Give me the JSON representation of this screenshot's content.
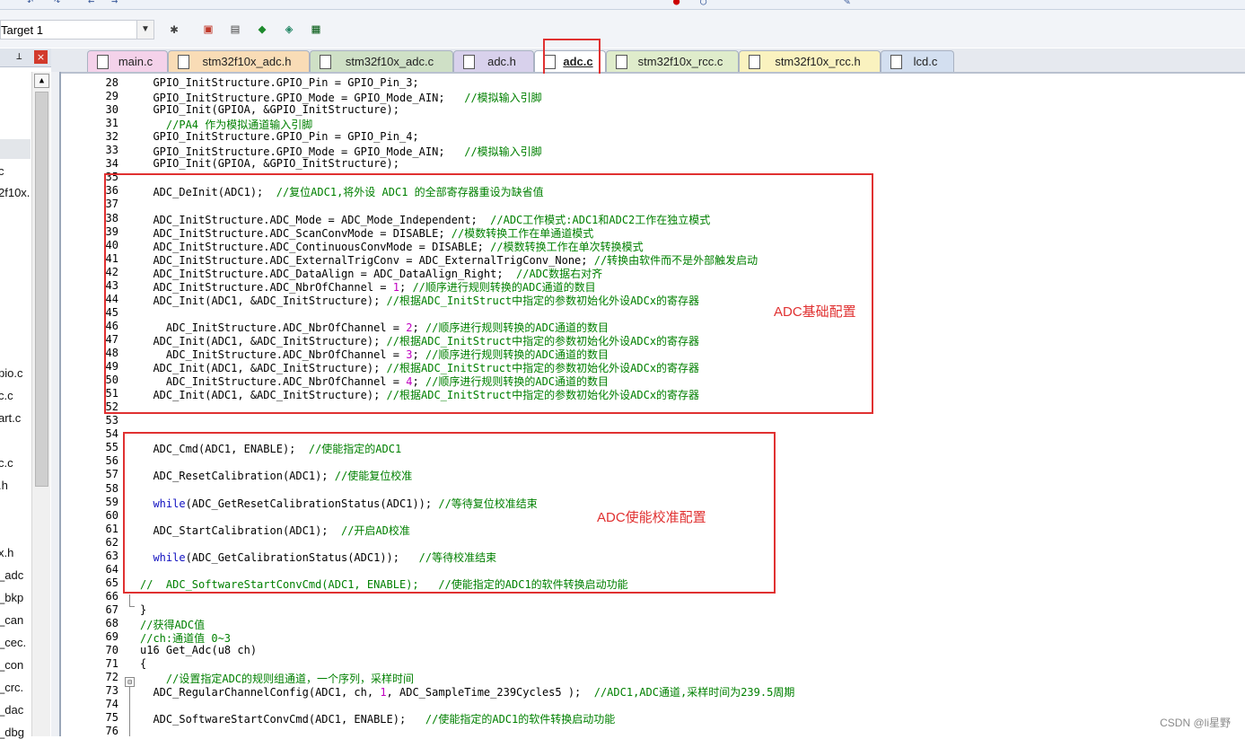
{
  "toolbar": {
    "target_label": "Target 1"
  },
  "tabs": [
    {
      "label": "main.c"
    },
    {
      "label": "stm32f10x_adc.h"
    },
    {
      "label": "stm32f10x_adc.c"
    },
    {
      "label": "adc.h"
    },
    {
      "label": "adc.c"
    },
    {
      "label": "stm32f10x_rcc.c"
    },
    {
      "label": "stm32f10x_rcc.h"
    },
    {
      "label": "lcd.c"
    }
  ],
  "project_pane": {
    "items": [
      "c",
      "2f10x.",
      "pio.c",
      "c.c",
      "art.c",
      "c.c",
      ".h",
      "x.h",
      "_adc",
      "_bkp",
      "_can",
      "_cec.",
      "_con",
      "_crc.",
      "_dac",
      "_dbg"
    ]
  },
  "editor": {
    "lines": [
      {
        "n": "28",
        "t": "  GPIO_InitStructure.GPIO_Pin = GPIO_Pin_3;"
      },
      {
        "n": "29",
        "t": "  GPIO_InitStructure.GPIO_Mode = GPIO_Mode_AIN;   //模拟输入引脚"
      },
      {
        "n": "30",
        "t": "  GPIO_Init(GPIOA, &GPIO_InitStructure);"
      },
      {
        "n": "31",
        "t": "    //PA4 作为模拟通道输入引脚"
      },
      {
        "n": "32",
        "t": "  GPIO_InitStructure.GPIO_Pin = GPIO_Pin_4;"
      },
      {
        "n": "33",
        "t": "  GPIO_InitStructure.GPIO_Mode = GPIO_Mode_AIN;   //模拟输入引脚"
      },
      {
        "n": "34",
        "t": "  GPIO_Init(GPIOA, &GPIO_InitStructure);"
      },
      {
        "n": "35",
        "t": ""
      },
      {
        "n": "36",
        "t": "  ADC_DeInit(ADC1);  //复位ADC1,将外设 ADC1 的全部寄存器重设为缺省值"
      },
      {
        "n": "37",
        "t": ""
      },
      {
        "n": "38",
        "t": "  ADC_InitStructure.ADC_Mode = ADC_Mode_Independent;  //ADC工作模式:ADC1和ADC2工作在独立模式"
      },
      {
        "n": "39",
        "t": "  ADC_InitStructure.ADC_ScanConvMode = DISABLE; //模数转换工作在单通道模式"
      },
      {
        "n": "40",
        "t": "  ADC_InitStructure.ADC_ContinuousConvMode = DISABLE; //模数转换工作在单次转换模式"
      },
      {
        "n": "41",
        "t": "  ADC_InitStructure.ADC_ExternalTrigConv = ADC_ExternalTrigConv_None; //转换由软件而不是外部触发启动"
      },
      {
        "n": "42",
        "t": "  ADC_InitStructure.ADC_DataAlign = ADC_DataAlign_Right;  //ADC数据右对齐"
      },
      {
        "n": "43",
        "t": "  ADC_InitStructure.ADC_NbrOfChannel = 1; //顺序进行规则转换的ADC通道的数目"
      },
      {
        "n": "44",
        "t": "  ADC_Init(ADC1, &ADC_InitStructure); //根据ADC_InitStruct中指定的参数初始化外设ADCx的寄存器"
      },
      {
        "n": "45",
        "t": ""
      },
      {
        "n": "46",
        "t": "    ADC_InitStructure.ADC_NbrOfChannel = 2; //顺序进行规则转换的ADC通道的数目"
      },
      {
        "n": "47",
        "t": "  ADC_Init(ADC1, &ADC_InitStructure); //根据ADC_InitStruct中指定的参数初始化外设ADCx的寄存器"
      },
      {
        "n": "48",
        "t": "    ADC_InitStructure.ADC_NbrOfChannel = 3; //顺序进行规则转换的ADC通道的数目"
      },
      {
        "n": "49",
        "t": "  ADC_Init(ADC1, &ADC_InitStructure); //根据ADC_InitStruct中指定的参数初始化外设ADCx的寄存器"
      },
      {
        "n": "50",
        "t": "    ADC_InitStructure.ADC_NbrOfChannel = 4; //顺序进行规则转换的ADC通道的数目"
      },
      {
        "n": "51",
        "t": "  ADC_Init(ADC1, &ADC_InitStructure); //根据ADC_InitStruct中指定的参数初始化外设ADCx的寄存器"
      },
      {
        "n": "52",
        "t": ""
      },
      {
        "n": "53",
        "t": ""
      },
      {
        "n": "54",
        "t": ""
      },
      {
        "n": "55",
        "t": "  ADC_Cmd(ADC1, ENABLE);  //使能指定的ADC1"
      },
      {
        "n": "56",
        "t": ""
      },
      {
        "n": "57",
        "t": "  ADC_ResetCalibration(ADC1); //使能复位校准"
      },
      {
        "n": "58",
        "t": ""
      },
      {
        "n": "59",
        "t": "  while(ADC_GetResetCalibrationStatus(ADC1)); //等待复位校准结束"
      },
      {
        "n": "60",
        "t": ""
      },
      {
        "n": "61",
        "t": "  ADC_StartCalibration(ADC1);  //开启AD校准"
      },
      {
        "n": "62",
        "t": ""
      },
      {
        "n": "63",
        "t": "  while(ADC_GetCalibrationStatus(ADC1));   //等待校准结束"
      },
      {
        "n": "64",
        "t": ""
      },
      {
        "n": "65",
        "t": "//  ADC_SoftwareStartConvCmd(ADC1, ENABLE);   //使能指定的ADC1的软件转换启动功能"
      },
      {
        "n": "66",
        "t": ""
      },
      {
        "n": "67",
        "t": "}"
      },
      {
        "n": "68",
        "t": "//获得ADC值"
      },
      {
        "n": "69",
        "t": "//ch:通道值 0~3"
      },
      {
        "n": "70",
        "t": "u16 Get_Adc(u8 ch)"
      },
      {
        "n": "71",
        "t": "{"
      },
      {
        "n": "72",
        "t": "    //设置指定ADC的规则组通道，一个序列，采样时间"
      },
      {
        "n": "73",
        "t": "  ADC_RegularChannelConfig(ADC1, ch, 1, ADC_SampleTime_239Cycles5 );  //ADC1,ADC通道,采样时间为239.5周期"
      },
      {
        "n": "74",
        "t": ""
      },
      {
        "n": "75",
        "t": "  ADC_SoftwareStartConvCmd(ADC1, ENABLE);   //使能指定的ADC1的软件转换启动功能"
      },
      {
        "n": "76",
        "t": ""
      }
    ]
  },
  "annotations": {
    "basic_config": "ADC基础配置",
    "enable_calib_config": "ADC使能校准配置"
  },
  "watermark": "CSDN @li星野",
  "colors": {
    "comment": "#008000",
    "keyword": "#1010c0",
    "number": "#c000c0",
    "highlight_box": "#e03131"
  }
}
